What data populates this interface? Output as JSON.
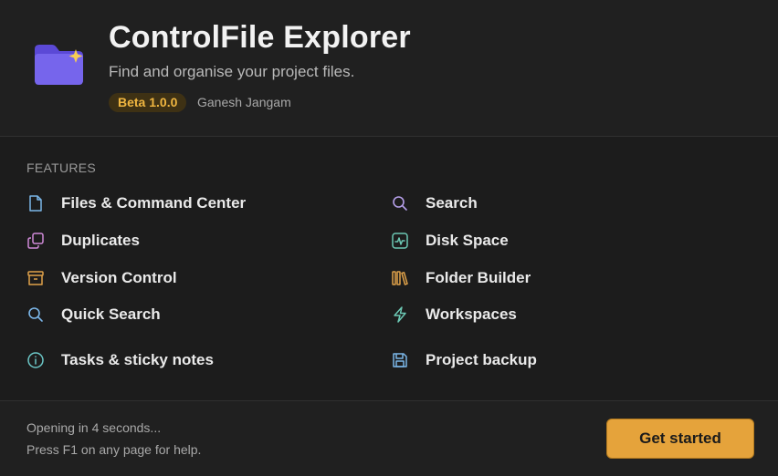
{
  "app": {
    "title": "ControlFile Explorer",
    "subtitle": "Find and organise your project files.",
    "version": "Beta 1.0.0",
    "author": "Ganesh Jangam",
    "logo_icon": "folder-sparkle-icon"
  },
  "features": {
    "heading": "FEATURES",
    "left": [
      {
        "label": "Files & Command Center",
        "icon": "file-icon",
        "color": "#7bb6e8"
      },
      {
        "label": "Duplicates",
        "icon": "copy-icon",
        "color": "#d08ad8"
      },
      {
        "label": "Version Control",
        "icon": "archive-icon",
        "color": "#e0a24a"
      },
      {
        "label": "Quick Search",
        "icon": "search-icon",
        "color": "#7bb6e8"
      },
      {
        "label": "Tasks & sticky notes",
        "icon": "info-icon",
        "color": "#6cc8c8"
      }
    ],
    "right": [
      {
        "label": "Search",
        "icon": "search-icon",
        "color": "#b49ee8"
      },
      {
        "label": "Disk Space",
        "icon": "activity-icon",
        "color": "#6cc8b4"
      },
      {
        "label": "Folder Builder",
        "icon": "library-icon",
        "color": "#e0a24a"
      },
      {
        "label": "Workspaces",
        "icon": "lightning-icon",
        "color": "#6cc8b4"
      },
      {
        "label": "Project backup",
        "icon": "save-icon",
        "color": "#7bb6e8"
      }
    ]
  },
  "footer": {
    "countdown": "Opening in 4 seconds...",
    "help_hint": "Press F1 on any page for help.",
    "get_started_label": "Get started"
  },
  "colors": {
    "background": "#1c1c1c",
    "accent": "#e5a33b",
    "logo": "#6f5ce6"
  }
}
